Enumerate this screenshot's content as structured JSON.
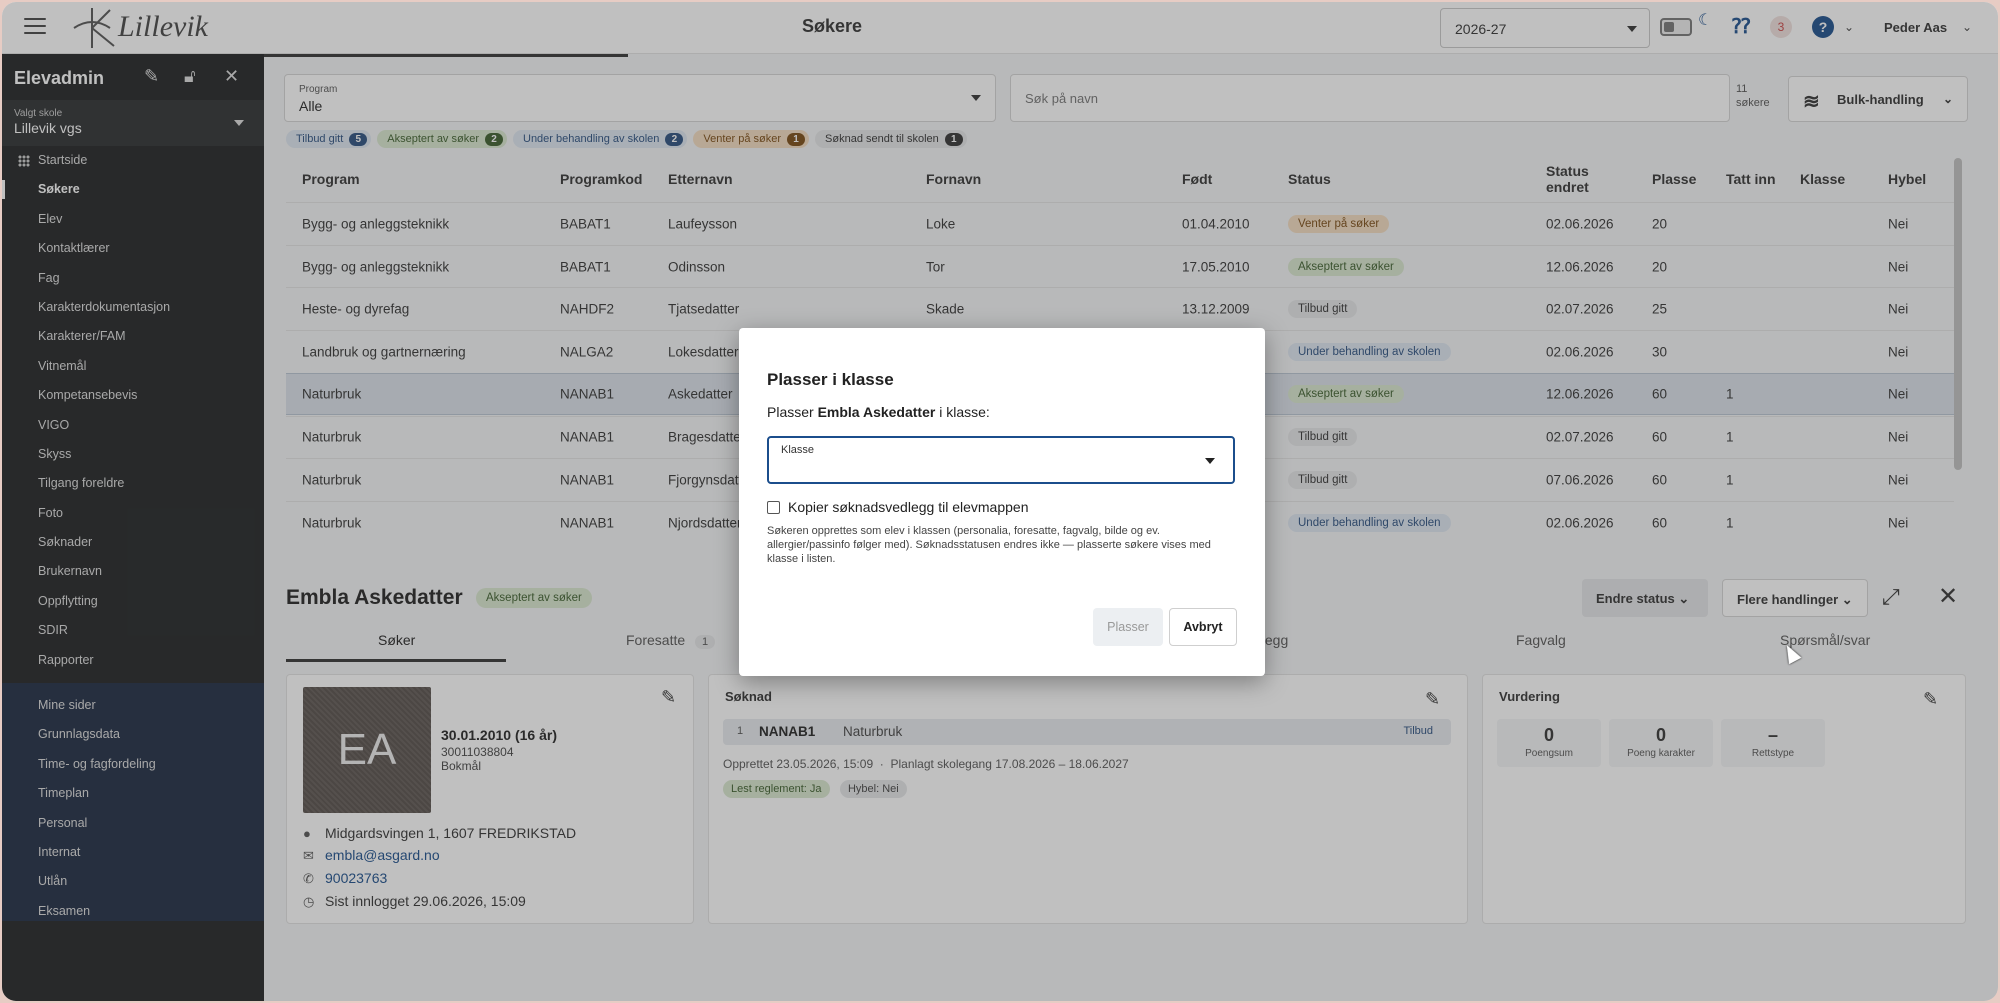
{
  "topbar": {
    "title": "Søkere",
    "logo_text": "Lillevik",
    "year": "2026-27",
    "notif_count": "3",
    "help": "?",
    "user": "Peder Aas"
  },
  "sidebar": {
    "title": "Elevadmin",
    "school_label": "Valgt skole",
    "school": "Lillevik vgs",
    "items": [
      "Startside",
      "Søkere",
      "Elev",
      "Kontaktlærer",
      "Fag",
      "Karakterdokumentasjon",
      "Karakterer/FAM",
      "Vitnemål",
      "Kompetansebevis",
      "VIGO",
      "Skyss",
      "Tilgang foreldre",
      "Foto",
      "Søknader",
      "Brukernavn",
      "Oppflytting",
      "SDIR",
      "Rapporter"
    ],
    "items2": [
      "Mine sider",
      "Grunnlagsdata",
      "Time- og fagfordeling",
      "Timeplan",
      "Personal",
      "Internat",
      "Utlån",
      "Eksamen"
    ]
  },
  "filters": {
    "program_label": "Program",
    "program_value": "Alle",
    "search_placeholder": "Søk på navn",
    "count_num": "11",
    "count_label": "søkere",
    "bulk": "Bulk-handling"
  },
  "chips": [
    {
      "label": "Tilbud gitt",
      "count": "5",
      "bg": "#dde6f1",
      "fg": "#2a4f7f",
      "cbg": "#2a4f7f"
    },
    {
      "label": "Akseptert av søker",
      "count": "2",
      "bg": "#d9e7cf",
      "fg": "#3b5e2b",
      "cbg": "#3b5e2b"
    },
    {
      "label": "Under behandling av skolen",
      "count": "2",
      "bg": "#dde6f1",
      "fg": "#2a4f7f",
      "cbg": "#2a4f7f"
    },
    {
      "label": "Venter på søker",
      "count": "1",
      "bg": "#f4dcc0",
      "fg": "#7a4a12",
      "cbg": "#7a4a12"
    },
    {
      "label": "Søknad sendt til skolen",
      "count": "1",
      "bg": "#e5e6e8",
      "fg": "#333",
      "cbg": "#333"
    }
  ],
  "table": {
    "headers": [
      "Program",
      "Programkod",
      "Etternavn",
      "Fornavn",
      "Født",
      "Status",
      "Status endret",
      "Plasse",
      "Tatt inn",
      "Klasse",
      "Hybel"
    ],
    "rows": [
      [
        "Bygg- og anleggsteknikk",
        "BABAT1",
        "Laufeysson",
        "Loke",
        "01.04.2010",
        "Venter på søker",
        "02.06.2026",
        "20",
        "",
        "",
        "Nei"
      ],
      [
        "Bygg- og anleggsteknikk",
        "BABAT1",
        "Odinsson",
        "Tor",
        "17.05.2010",
        "Akseptert av søker",
        "12.06.2026",
        "20",
        "",
        "",
        "Nei"
      ],
      [
        "Heste- og dyrefag",
        "NAHDF2",
        "Tjatsedatter",
        "Skade",
        "13.12.2009",
        "Tilbud gitt",
        "02.07.2026",
        "25",
        "",
        "",
        "Nei"
      ],
      [
        "Landbruk og gartnernæring",
        "NALGA2",
        "Lokesdatter",
        "",
        "",
        "Under behandling av skolen",
        "02.06.2026",
        "30",
        "",
        "",
        "Nei"
      ],
      [
        "Naturbruk",
        "NANAB1",
        "Askedatter",
        "",
        "",
        "Akseptert av søker",
        "12.06.2026",
        "60",
        "1",
        "",
        "Nei"
      ],
      [
        "Naturbruk",
        "NANAB1",
        "Bragesdatter",
        "",
        "",
        "Tilbud gitt",
        "02.07.2026",
        "60",
        "1",
        "",
        "Nei"
      ],
      [
        "Naturbruk",
        "NANAB1",
        "Fjorgynsdatter",
        "",
        "",
        "Tilbud gitt",
        "07.06.2026",
        "60",
        "1",
        "",
        "Nei"
      ],
      [
        "Naturbruk",
        "NANAB1",
        "Njordsdatter",
        "",
        "",
        "Under behandling av skolen",
        "02.06.2026",
        "60",
        "1",
        "",
        "Nei"
      ]
    ]
  },
  "status_colors": {
    "Venter på søker": [
      "#f4dcc0",
      "#7a4a12"
    ],
    "Akseptert av søker": [
      "#d9e7cf",
      "#3b5e2b"
    ],
    "Tilbud gitt": [
      "#e5e6e8",
      "#333"
    ],
    "Under behandling av skolen": [
      "#dde6f1",
      "#2a4f7f"
    ]
  },
  "detail": {
    "name": "Embla Askedatter",
    "status": "Akseptert av søker",
    "endre": "Endre status",
    "flere": "Flere handlinger",
    "tabs": [
      "Søker",
      "Foresatte",
      "dlegg",
      "Fagvalg",
      "Spørsmål/svar"
    ],
    "foresatte_count": "1",
    "avatar_initials": "EA",
    "dob": "30.01.2010 (16 år)",
    "pnr": "30011038804",
    "lang": "Bokmål",
    "address": "Midgardsvingen 1, 1607 FREDRIKSTAD",
    "email": "embla@asgard.no",
    "phone": "90023763",
    "last_login": "Sist innlogget 29.06.2026, 15:09",
    "soknad": {
      "title": "Søknad",
      "nr": "1",
      "code": "NANAB1",
      "name": "Naturbruk",
      "tag": "Tilbud",
      "created": "Opprettet 23.05.2026, 15:09",
      "planned": "Planlagt skolegang 17.08.2026 – 18.06.2027",
      "tag1": "Lest reglement: Ja",
      "tag2": "Hybel: Nei"
    },
    "vurdering": {
      "title": "Vurdering",
      "boxes": [
        {
          "n": "0",
          "l": "Poengsum"
        },
        {
          "n": "0",
          "l": "Poeng karakter"
        },
        {
          "n": "–",
          "l": "Rettstype"
        }
      ]
    }
  },
  "modal": {
    "title": "Plasser i klasse",
    "sub_pre": "Plasser ",
    "sub_name": "Embla Askedatter",
    "sub_post": " i klasse:",
    "klasse_label": "Klasse",
    "checkbox_label": "Kopier søknadsvedlegg til elevmappen",
    "note": "Søkeren opprettes som elev i klassen (personalia, foresatte, fagvalg, bilde og ev. allergier/passinfo følger med). Søknadsstatusen endres ikke — plasserte søkere vises med klasse i listen.",
    "btn_plasser": "Plasser",
    "btn_avbryt": "Avbryt"
  }
}
